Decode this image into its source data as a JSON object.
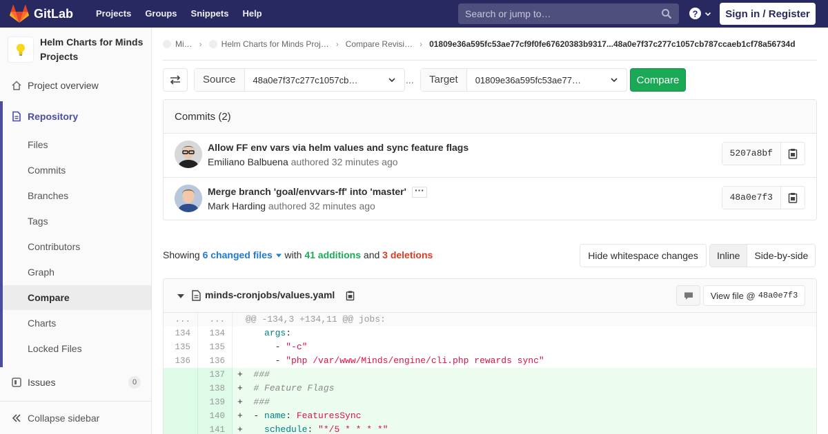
{
  "navbar": {
    "brand": "GitLab",
    "links": [
      "Projects",
      "Groups",
      "Snippets",
      "Help"
    ],
    "search_placeholder": "Search or jump to…",
    "signin_label": "Sign in / Register"
  },
  "sidebar": {
    "project_name": "Helm Charts for Minds Projects",
    "overview": "Project overview",
    "repository": "Repository",
    "repo_items": [
      "Files",
      "Commits",
      "Branches",
      "Tags",
      "Contributors",
      "Graph",
      "Compare",
      "Charts",
      "Locked Files"
    ],
    "active_item": "Compare",
    "issues": "Issues",
    "issues_count": "0",
    "collapse": "Collapse sidebar"
  },
  "breadcrumb": {
    "items": [
      "Mi…",
      "Helm Charts for Minds Proj…",
      "Compare Revisi…"
    ],
    "current": "01809e36a595fc53ae77cf9f0fe67620383b9317...48a0e7f37c277c1057cb787ccaeb1cf78a56734d"
  },
  "compare": {
    "source_label": "Source",
    "source_value": "48a0e7f37c277c1057cb…",
    "separator": "...",
    "target_label": "Target",
    "target_value": "01809e36a595fc53ae77…",
    "button": "Compare"
  },
  "commits": {
    "header": "Commits (2)",
    "items": [
      {
        "title": "Allow FF env vars via helm values and sync feature flags",
        "author": "Emiliano Balbuena",
        "meta": " authored 32 minutes ago",
        "sha": "5207a8bf"
      },
      {
        "title": "Merge branch 'goal/envvars-ff' into 'master'",
        "author": "Mark Harding",
        "meta": " authored 32 minutes ago",
        "sha": "48a0e7f3"
      }
    ]
  },
  "stats": {
    "showing": "Showing ",
    "files": "6 changed files",
    "with": " with ",
    "additions": "41 additions",
    "and": " and ",
    "deletions": "3 deletions",
    "whitespace_btn": "Hide whitespace changes",
    "inline": "Inline",
    "side_by_side": "Side-by-side"
  },
  "file": {
    "name": "minds-cronjobs/values.yaml",
    "view_file_label": "View file @",
    "view_file_sha": "48a0e7f3",
    "hunk_header": "@@ -134,3 +134,11 @@ jobs:",
    "lines": [
      {
        "type": "context",
        "old": "134",
        "new": "134"
      },
      {
        "type": "context",
        "old": "135",
        "new": "135"
      },
      {
        "type": "context",
        "old": "136",
        "new": "136"
      },
      {
        "type": "added",
        "old": "",
        "new": "137"
      },
      {
        "type": "added",
        "old": "",
        "new": "138"
      },
      {
        "type": "added",
        "old": "",
        "new": "139"
      },
      {
        "type": "added",
        "old": "",
        "new": "140"
      },
      {
        "type": "added",
        "old": "",
        "new": "141"
      }
    ],
    "code": {
      "l134_key": "args",
      "l135_str": "\"-c\"",
      "l136_str": "\"php /var/www/Minds/engine/cli.php rewards sync\"",
      "l137": "###",
      "l138": "# Feature Flags",
      "l139": "###",
      "l140_key": "name",
      "l140_val": "FeaturesSync",
      "l141_key": "schedule",
      "l141_val": "\"*/5 * * * *\""
    }
  },
  "colors": {
    "navbar": "#292961",
    "accent": "#4b4ba3",
    "success": "#1aaa55",
    "danger": "#db3b21",
    "link": "#1f78d1"
  }
}
